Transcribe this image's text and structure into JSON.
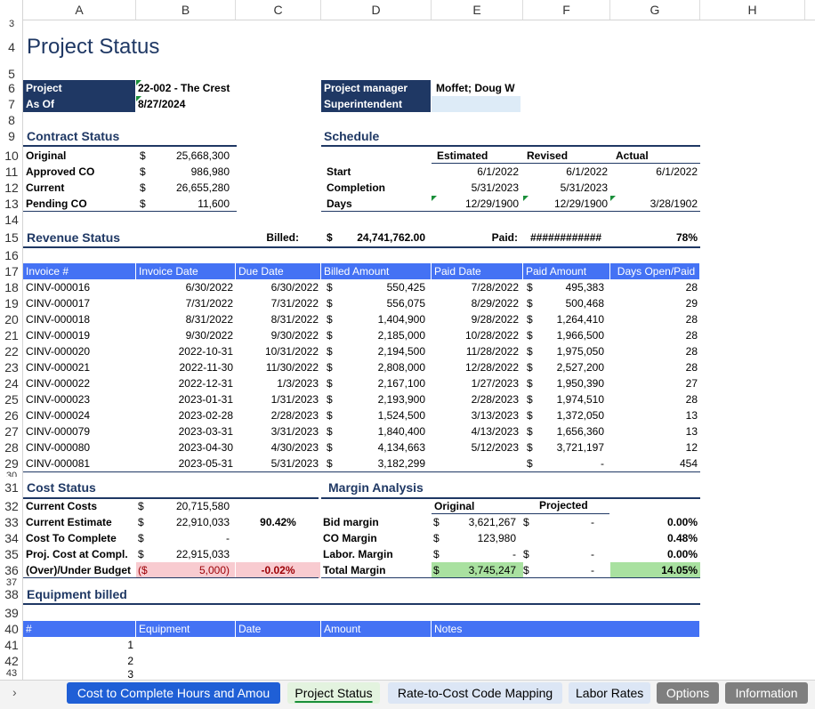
{
  "columns": [
    "A",
    "B",
    "C",
    "D",
    "E",
    "F",
    "G",
    "H"
  ],
  "rows": [
    "3",
    "4",
    "5",
    "6",
    "7",
    "8",
    "9",
    "10",
    "11",
    "12",
    "13",
    "14",
    "15",
    "16",
    "17",
    "18",
    "19",
    "20",
    "21",
    "22",
    "23",
    "24",
    "25",
    "26",
    "27",
    "28",
    "29",
    "30",
    "31",
    "32",
    "33",
    "34",
    "35",
    "36",
    "37",
    "38",
    "39",
    "40",
    "41",
    "42",
    "43"
  ],
  "title": "Project Status",
  "project": {
    "project_label": "Project",
    "project_value": "22-002 - The Crest",
    "asof_label": "As Of",
    "asof_value": "8/27/2024",
    "pm_label": "Project manager",
    "pm_value": "Moffet; Doug W",
    "super_label": "Superintendent",
    "super_value": ""
  },
  "contract": {
    "title": "Contract Status",
    "rows": [
      {
        "label": "Original",
        "cur": "$",
        "value": "25,668,300"
      },
      {
        "label": "Approved CO",
        "cur": "$",
        "value": "986,980"
      },
      {
        "label": "Current",
        "cur": "$",
        "value": "26,655,280"
      },
      {
        "label": "Pending CO",
        "cur": "$",
        "value": "11,600"
      }
    ]
  },
  "schedule": {
    "title": "Schedule",
    "headers": [
      "Estimated",
      "Revised",
      "Actual"
    ],
    "rows": [
      {
        "label": "Start",
        "est": "6/1/2022",
        "rev": "6/1/2022",
        "act": "6/1/2022"
      },
      {
        "label": "Completion",
        "est": "5/31/2023",
        "rev": "5/31/2023",
        "act": ""
      },
      {
        "label": "Days",
        "est": "12/29/1900",
        "rev": "12/29/1900",
        "act": "3/28/1902"
      }
    ]
  },
  "revenue": {
    "title": "Revenue Status",
    "billed_label": "Billed:",
    "billed_cur": "$",
    "billed_value": "24,741,762.00",
    "paid_label": "Paid:",
    "paid_value": "############",
    "pct": "78%"
  },
  "invoice_headers": [
    "Invoice #",
    "Invoice Date",
    "Due Date",
    "Billed Amount",
    "Paid Date",
    "Paid Amount",
    "Days Open/Paid"
  ],
  "invoices": [
    {
      "num": "CINV-000016",
      "inv": "6/30/2022",
      "due": "6/30/2022",
      "billed": "550,425",
      "pdate": "7/28/2022",
      "paid": "495,383",
      "days": "28"
    },
    {
      "num": "CINV-000017",
      "inv": "7/31/2022",
      "due": "7/31/2022",
      "billed": "556,075",
      "pdate": "8/29/2022",
      "paid": "500,468",
      "days": "29"
    },
    {
      "num": "CINV-000018",
      "inv": "8/31/2022",
      "due": "8/31/2022",
      "billed": "1,404,900",
      "pdate": "9/28/2022",
      "paid": "1,264,410",
      "days": "28"
    },
    {
      "num": "CINV-000019",
      "inv": "9/30/2022",
      "due": "9/30/2022",
      "billed": "2,185,000",
      "pdate": "10/28/2022",
      "paid": "1,966,500",
      "days": "28"
    },
    {
      "num": "CINV-000020",
      "inv": "2022-10-31",
      "due": "10/31/2022",
      "billed": "2,194,500",
      "pdate": "11/28/2022",
      "paid": "1,975,050",
      "days": "28"
    },
    {
      "num": "CINV-000021",
      "inv": "2022-11-30",
      "due": "11/30/2022",
      "billed": "2,808,000",
      "pdate": "12/28/2022",
      "paid": "2,527,200",
      "days": "28"
    },
    {
      "num": "CINV-000022",
      "inv": "2022-12-31",
      "due": "1/3/2023",
      "billed": "2,167,100",
      "pdate": "1/27/2023",
      "paid": "1,950,390",
      "days": "27"
    },
    {
      "num": "CINV-000023",
      "inv": "2023-01-31",
      "due": "1/31/2023",
      "billed": "2,193,900",
      "pdate": "2/28/2023",
      "paid": "1,974,510",
      "days": "28"
    },
    {
      "num": "CINV-000024",
      "inv": "2023-02-28",
      "due": "2/28/2023",
      "billed": "1,524,500",
      "pdate": "3/13/2023",
      "paid": "1,372,050",
      "days": "13"
    },
    {
      "num": "CINV-000079",
      "inv": "2023-03-31",
      "due": "3/31/2023",
      "billed": "1,840,400",
      "pdate": "4/13/2023",
      "paid": "1,656,360",
      "days": "13"
    },
    {
      "num": "CINV-000080",
      "inv": "2023-04-30",
      "due": "4/30/2023",
      "billed": "4,134,663",
      "pdate": "5/12/2023",
      "paid": "3,721,197",
      "days": "12"
    },
    {
      "num": "CINV-000081",
      "inv": "2023-05-31",
      "due": "5/31/2023",
      "billed": "3,182,299",
      "pdate": "",
      "paid": "-",
      "days": "454"
    }
  ],
  "cost": {
    "title": "Cost Status",
    "rows": [
      {
        "label": "Current Costs",
        "cur": "$",
        "value": "20,715,580",
        "pct": ""
      },
      {
        "label": "Current Estimate",
        "cur": "$",
        "value": "22,910,033",
        "pct": "90.42%"
      },
      {
        "label": "Cost To Complete",
        "cur": "$",
        "value": "-",
        "pct": ""
      },
      {
        "label": "Proj. Cost at Compl.",
        "cur": "$",
        "value": "22,915,033",
        "pct": ""
      },
      {
        "label": "(Over)/Under Budget",
        "cur": "($",
        "value": "5,000)",
        "pct": "-0.02%"
      }
    ]
  },
  "margin": {
    "title": "Margin Analysis",
    "headers": [
      "Original",
      "Projected"
    ],
    "rows": [
      {
        "label": "Bid margin",
        "ocur": "$",
        "orig": "3,621,267",
        "pcur": "$",
        "proj": "-",
        "pct": "0.00%"
      },
      {
        "label": "CO Margin",
        "ocur": "$",
        "orig": "123,980",
        "pcur": "",
        "proj": "",
        "pct": "0.48%"
      },
      {
        "label": "Labor. Margin",
        "ocur": "$",
        "orig": "-",
        "pcur": "$",
        "proj": "-",
        "pct": "0.00%"
      },
      {
        "label": "Total Margin",
        "ocur": "$",
        "orig": "3,745,247",
        "pcur": "$",
        "proj": "-",
        "pct": "14.05%"
      }
    ]
  },
  "equipment": {
    "title": "Equipment billed",
    "headers": [
      "#",
      "Equipment",
      "Date",
      "Amount",
      "Notes"
    ],
    "rows": [
      "1",
      "2",
      "3"
    ]
  },
  "tabs": [
    {
      "label": "Cost to Complete Hours and Amou"
    },
    {
      "label": "Project Status"
    },
    {
      "label": "Rate-to-Cost Code Mapping"
    },
    {
      "label": "Labor Rates"
    },
    {
      "label": "Options"
    },
    {
      "label": "Information"
    }
  ],
  "colors": {
    "navy": "#1f3864",
    "header_blue": "#4472f4",
    "tab_blue": "#1f5fd6",
    "tab_light": "#dce6f5",
    "tab_gray": "#7f7f7f",
    "tab_green": "#e3f3df"
  }
}
